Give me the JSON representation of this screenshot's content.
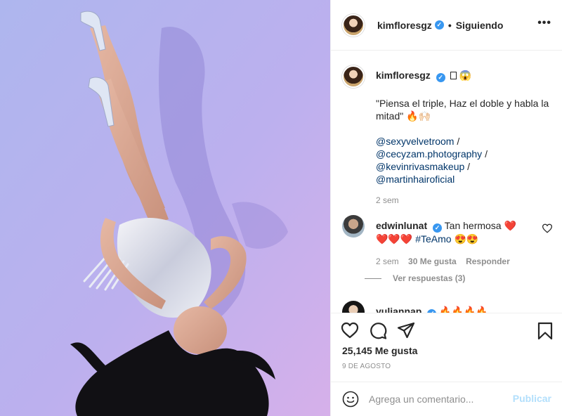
{
  "colors": {
    "link": "#003569",
    "verified": "#3897f0",
    "muted": "#8e8e8e",
    "publish_disabled": "#b2dffc"
  },
  "header": {
    "username": "kimfloresgz",
    "follow_dot": "•",
    "follow_status": "Siguiendo",
    "more_icon": "•••"
  },
  "caption": {
    "username": "kimfloresgz",
    "title_emoji": "😱",
    "quote": "\"Piensa el triple, Haz el doble y habla la mitad\"",
    "quote_emojis": "🔥🙌🏻",
    "mentions": [
      "@sexyvelvetroom",
      "@cecyzam.photography",
      "@kevinrivasmakeup",
      "@martinhairoficial"
    ],
    "separator": "/",
    "time": "2 sem"
  },
  "comments": [
    {
      "username": "edwinlunat",
      "text": "Tan hermosa",
      "emojis_a": "❤️",
      "emojis_b": "❤️❤️❤️",
      "hashtag": "#TeAmo",
      "emojis_c": "😍😍",
      "time": "2 sem",
      "likes": "30 Me gusta",
      "reply": "Responder",
      "view_replies": "Ver respuestas (3)"
    },
    {
      "username": "yuliannap",
      "emojis": "🔥🔥🔥🔥"
    }
  ],
  "actions": {
    "likes": "25,145 Me gusta",
    "date": "9 DE AGOSTO"
  },
  "add_comment": {
    "placeholder": "Agrega un comentario...",
    "publish": "Publicar"
  }
}
